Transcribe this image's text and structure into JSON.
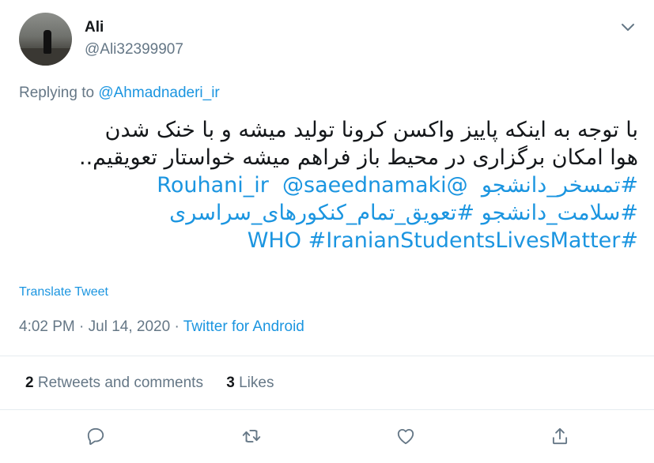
{
  "author": {
    "name": "Ali",
    "handle": "@Ali32399907"
  },
  "replying": {
    "prefix": "Replying to ",
    "mention": "@Ahmadnaderi_ir"
  },
  "tweet": {
    "line1": "با توجه به اینکه پاییز واکسن کرونا تولید میشه و با خنک شدن",
    "line2": "هوا امکان برگزاری در محیط باز فراهم میشه خواستار تعویقیم..",
    "line3_hashtag": "#تمسخر_دانشجو",
    "line3_mention1": "@Rouhani_ir",
    "line3_mention2": "@saeednamaki",
    "line4_hashtag1": "#سلامت_دانشجو",
    "line4_hashtag2": "#تعویق_تمام_کنکورهای_سراسری",
    "line5_hashtag1": "#WHO",
    "line5_hashtag2": "#IranianStudentsLivesMatter"
  },
  "translate_label": "Translate Tweet",
  "meta": {
    "time": "4:02 PM",
    "separator": " · ",
    "date": "Jul 14, 2020",
    "source": "Twitter for Android"
  },
  "stats": {
    "retweets_count": "2",
    "retweets_label": "Retweets and comments",
    "likes_count": "3",
    "likes_label": "Likes"
  },
  "icons": {
    "caret": "chevron-down-icon",
    "reply": "reply-icon",
    "retweet": "retweet-icon",
    "like": "heart-icon",
    "share": "share-icon"
  },
  "colors": {
    "link": "#1b95e0",
    "secondary_text": "#657786",
    "primary_text": "#14171a",
    "divider": "#e6ecf0"
  }
}
